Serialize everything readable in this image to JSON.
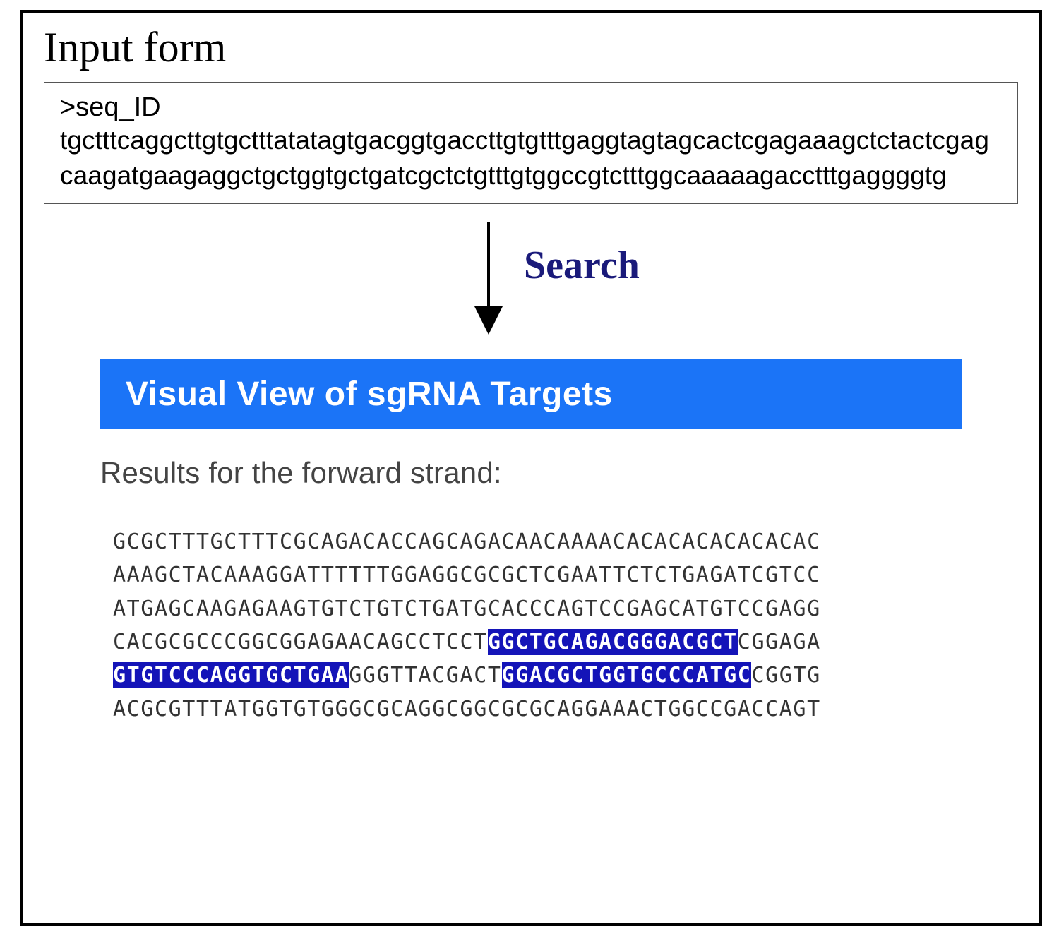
{
  "heading": "Input form",
  "input": {
    "fasta_header": ">seq_ID",
    "fasta_sequence": "tgctttcaggcttgtgctttatatagtgacggtgaccttgtgtttgaggtagtagcactcgagaaagctctactcgagcaagatgaagaggctgctggtgctgatcgctctgtttgtggccgtctttggcaaaaagacctttgaggggtg"
  },
  "search_label": "Search",
  "results": {
    "banner": "Visual View of sgRNA Targets",
    "subtitle": "Results for the forward strand:",
    "lines": [
      {
        "segments": [
          {
            "text": "GCGCTTTGCTTTCGCAGACACCAGCAGACAACAAAACACACACACACACAC",
            "hl": false
          }
        ]
      },
      {
        "segments": [
          {
            "text": "AAAGCTACAAAGGATTTTTTGGAGGCGCGCTCGAATTCTCTGAGATCGTCC",
            "hl": false
          }
        ]
      },
      {
        "segments": [
          {
            "text": "ATGAGCAAGAGAAGTGTCTGTCTGATGCACCCAGTCCGAGCATGTCCGAGG",
            "hl": false
          }
        ]
      },
      {
        "segments": [
          {
            "text": "CACGCGCCCGGCGGAGAACAGCCTCCT",
            "hl": false
          },
          {
            "text": "GGCTGCAGACGGGACGCT",
            "hl": true
          },
          {
            "text": "CGGAGA",
            "hl": false
          }
        ]
      },
      {
        "segments": [
          {
            "text": "GTGTCCCAGGTGCTGAA",
            "hl": true
          },
          {
            "text": "GGGTTACGACT",
            "hl": false
          },
          {
            "text": "GGACGCTGGTGCCCATGC",
            "hl": true
          },
          {
            "text": "CGGTG",
            "hl": false
          }
        ]
      },
      {
        "segments": [
          {
            "text": "ACGCGTTTATGGTGTGGGCGCAGGCGGCGCGCAGGAAACTGGCCGACCAGT",
            "hl": false
          }
        ]
      }
    ]
  }
}
